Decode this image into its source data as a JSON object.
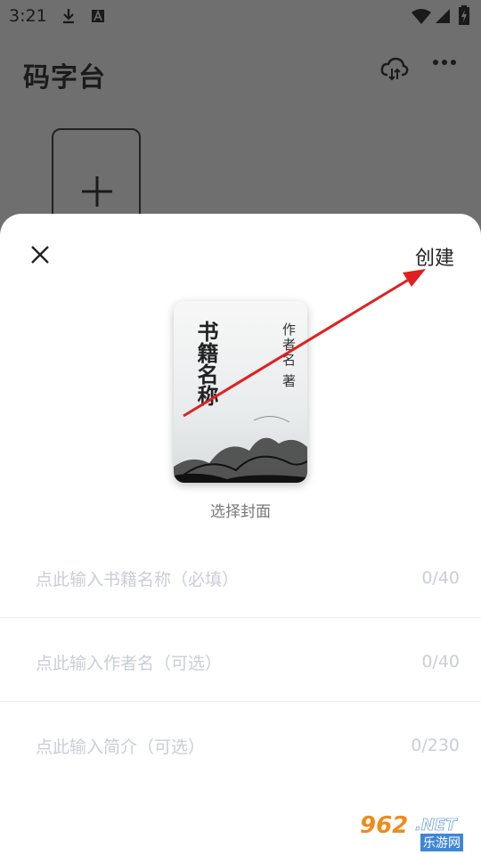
{
  "status_bar": {
    "time": "3:21"
  },
  "app": {
    "title": "码字台"
  },
  "sheet": {
    "create_label": "创建",
    "cover": {
      "title": "书籍名称",
      "author": "作者名 著",
      "choose_label": "选择封面"
    },
    "fields": [
      {
        "placeholder": "点此输入书籍名称（必填）",
        "count": "0/40"
      },
      {
        "placeholder": "点此输入作者名（可选）",
        "count": "0/40"
      },
      {
        "placeholder": "点此输入简介（可选）",
        "count": "0/230"
      }
    ]
  },
  "watermark": {
    "number": "962",
    "net": ".NET",
    "sub": "乐游网"
  },
  "colors": {
    "annotation_arrow": "#e02020",
    "placeholder": "#c8ced8"
  },
  "icons": [
    "download-icon",
    "a-box-icon",
    "wifi-icon",
    "signal-icon",
    "battery-charging-icon",
    "cloud-sync-icon",
    "more-icon",
    "plus-icon",
    "close-icon"
  ]
}
